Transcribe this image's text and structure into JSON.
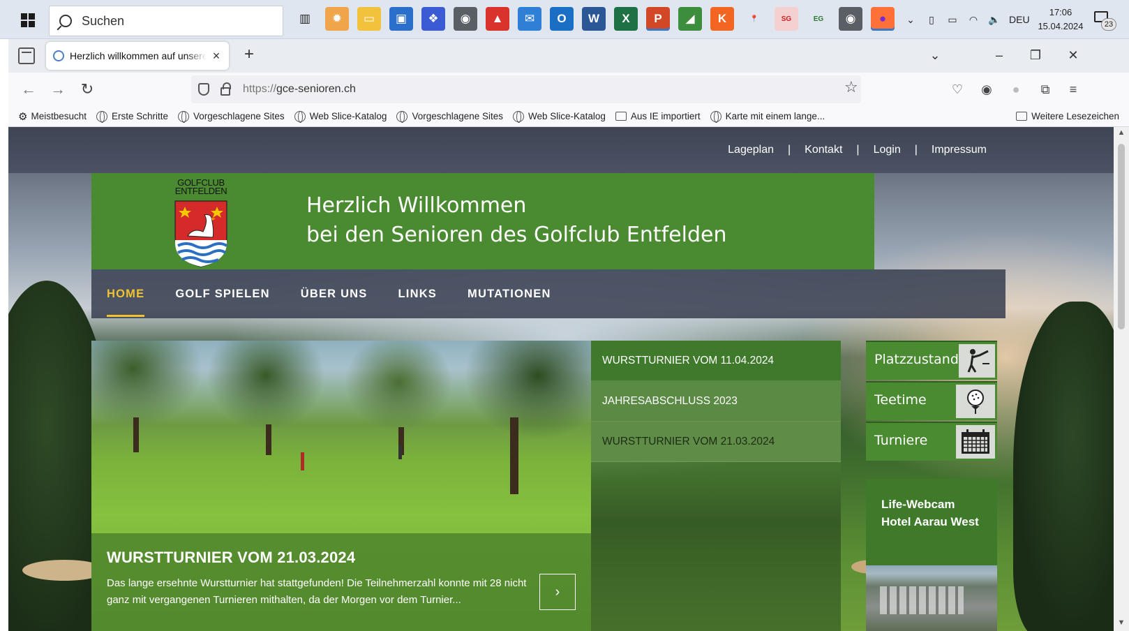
{
  "taskbar": {
    "search_placeholder": "Suchen",
    "apps": [
      {
        "name": "task-view-icon",
        "color": "#dfe6f0",
        "glyph": "▥",
        "fg": "#222"
      },
      {
        "name": "photos-icon",
        "color": "#f0a54a",
        "glyph": "✹",
        "fg": "#fff"
      },
      {
        "name": "file-explorer-icon",
        "color": "#f3c23c",
        "glyph": "▭",
        "fg": "#fff"
      },
      {
        "name": "store-icon",
        "color": "#2a6fc9",
        "glyph": "▣",
        "fg": "#fff"
      },
      {
        "name": "dropbox-icon",
        "color": "#3a5bd4",
        "glyph": "❖",
        "fg": "#fff"
      },
      {
        "name": "camera-app-icon",
        "color": "#5a5f66",
        "glyph": "◉",
        "fg": "#fff"
      },
      {
        "name": "triangle-app-icon",
        "color": "#d9332b",
        "glyph": "▲",
        "fg": "#fff"
      },
      {
        "name": "mail-icon",
        "color": "#2f7fd6",
        "glyph": "✉",
        "fg": "#fff"
      },
      {
        "name": "outlook-icon",
        "color": "#1a6fc4",
        "glyph": "O",
        "fg": "#fff"
      },
      {
        "name": "word-icon",
        "color": "#2b5797",
        "glyph": "W",
        "fg": "#fff"
      },
      {
        "name": "excel-icon",
        "color": "#1e7145",
        "glyph": "X",
        "fg": "#fff"
      },
      {
        "name": "powerpoint-icon",
        "color": "#d24726",
        "glyph": "P",
        "fg": "#fff"
      },
      {
        "name": "maps-app-icon",
        "color": "#3c8d3c",
        "glyph": "◢",
        "fg": "#fff"
      },
      {
        "name": "k-app-icon",
        "color": "#f26522",
        "glyph": "K",
        "fg": "#fff"
      },
      {
        "name": "google-maps-icon",
        "color": "#dfe6f0",
        "glyph": "📍",
        "fg": "#e33"
      },
      {
        "name": "swiss-golf-icon",
        "color": "#f4d0d0",
        "glyph": "SG",
        "fg": "#c22"
      },
      {
        "name": "enni-golf-icon",
        "color": "#dfe6f0",
        "glyph": "EG",
        "fg": "#2a7a2a"
      },
      {
        "name": "camera-app-2-icon",
        "color": "#5a5f66",
        "glyph": "◉",
        "fg": "#fff"
      },
      {
        "name": "firefox-icon",
        "color": "#ff7139",
        "glyph": "●",
        "fg": "#7a2ad1"
      }
    ],
    "language": "DEU",
    "time": "17:06",
    "date": "15.04.2024",
    "notification_count": "23"
  },
  "browser": {
    "tab_title": "Herzlich willkommen auf unserer Webseite",
    "url_protocol": "https://",
    "url_host": "gce-senioren.ch",
    "bookmarks": [
      {
        "icon": "gear",
        "label": "Meistbesucht"
      },
      {
        "icon": "globe",
        "label": "Erste Schritte"
      },
      {
        "icon": "globe",
        "label": "Vorgeschlagene Sites"
      },
      {
        "icon": "globe",
        "label": "Web Slice-Katalog"
      },
      {
        "icon": "globe",
        "label": "Vorgeschlagene Sites"
      },
      {
        "icon": "globe",
        "label": "Web Slice-Katalog"
      },
      {
        "icon": "folder",
        "label": "Aus IE importiert"
      },
      {
        "icon": "globe",
        "label": "Karte mit einem lange..."
      }
    ],
    "other_bookmarks": "Weitere Lesezeichen"
  },
  "site": {
    "top_links": [
      "Lageplan",
      "Kontakt",
      "Login",
      "Impressum"
    ],
    "logo_text_line1": "GOLFCLUB",
    "logo_text_line2": "ENTFELDEN",
    "headline_line1": "Herzlich Willkommen",
    "headline_line2": "bei den Senioren des Golfclub Entfelden",
    "nav": [
      "HOME",
      "GOLF SPIELEN",
      "ÜBER UNS",
      "LINKS",
      "MUTATIONEN"
    ],
    "active_nav": "HOME",
    "slider": {
      "title": "WURSTTURNIER VOM 21.03.2024",
      "text": "Das lange ersehnte Wurstturnier hat stattgefunden! Die Teilnehmerzahl konnte mit 28 nicht ganz mit vergangenen Turnieren mithalten, da der Morgen vor dem Turnier...",
      "next_glyph": "›"
    },
    "news": [
      "WURSTTURNIER VOM 11.04.2024",
      "JAHRESABSCHLUSS 2023",
      "WURSTTURNIER VOM 21.03.2024"
    ],
    "quick_links": [
      {
        "label": "Platzzustand",
        "icon": "golfer-icon"
      },
      {
        "label": "Teetime",
        "icon": "golf-ball-tee-icon"
      },
      {
        "label": "Turniere",
        "icon": "calendar-icon"
      }
    ],
    "webcam_title": "Life-Webcam Hotel Aarau West",
    "colors": {
      "green": "#4a8a31",
      "nav_active": "#f1c232",
      "topbar": "#434b5b"
    }
  }
}
